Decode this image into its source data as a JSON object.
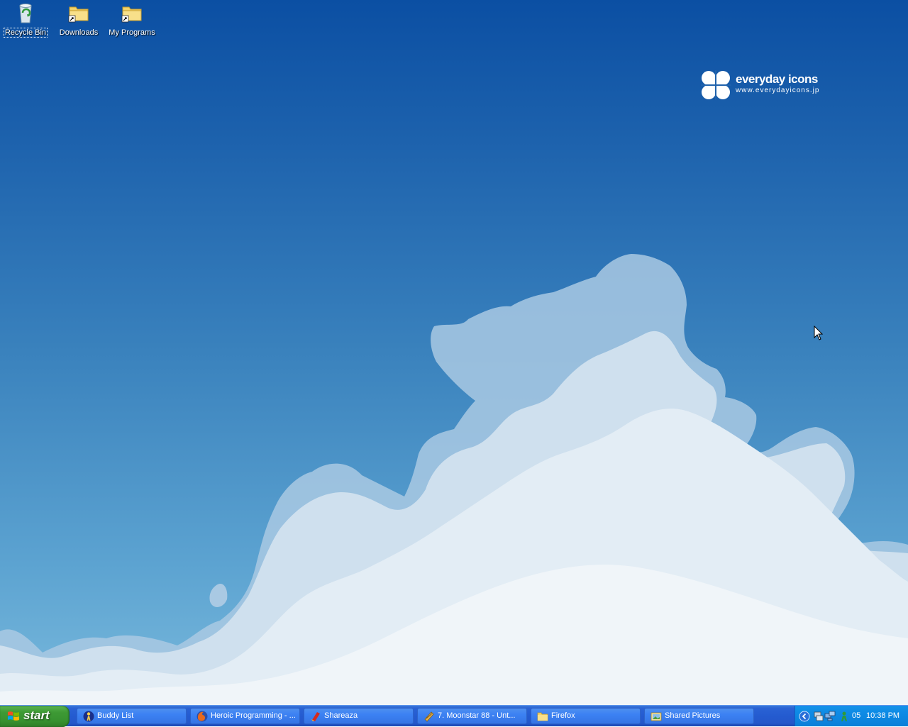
{
  "desktop": {
    "icons": [
      {
        "label": "Recycle Bin",
        "icon": "recycle-bin-icon"
      },
      {
        "label": "Downloads",
        "icon": "folder-shortcut-icon"
      },
      {
        "label": "My Programs",
        "icon": "folder-shortcut-icon"
      }
    ],
    "wallpaper": {
      "brand_name": "everyday icons",
      "brand_url": "www.everydayicons.jp",
      "sky_top": "#0b4fa3",
      "sky_bottom": "#79b9dc",
      "cloud_color": "#dde9f3"
    }
  },
  "taskbar": {
    "start_label": "start",
    "start_icon": "windows-flag-icon",
    "buttons": [
      {
        "label": "Buddy List",
        "icon": "aim-buddy-icon"
      },
      {
        "label": "Heroic Programming - ...",
        "icon": "firefox-icon"
      },
      {
        "label": "Shareaza",
        "icon": "shareaza-icon"
      },
      {
        "label": "7. Moonstar 88 - Unt...",
        "icon": "winamp-icon"
      },
      {
        "label": "Firefox",
        "icon": "folder-icon"
      },
      {
        "label": "Shared Pictures",
        "icon": "shared-pictures-icon"
      }
    ],
    "tray": {
      "icons": [
        "show-hidden-icons-chevron",
        "network-monitor-icon",
        "network-connection-icon",
        "messenger-icon"
      ],
      "badge_text": "05",
      "clock": "10:38 PM"
    }
  }
}
